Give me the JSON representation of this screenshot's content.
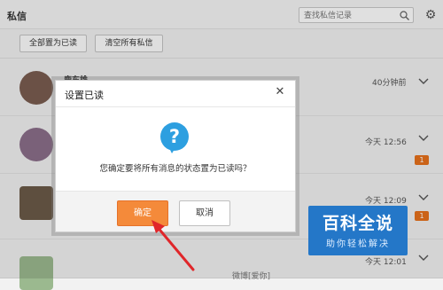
{
  "header": {
    "title": "私信",
    "search_placeholder": "查找私信记录"
  },
  "toolbar": {
    "mark_all_read": "全部置为已读",
    "clear_all": "清空所有私信"
  },
  "conversations": [
    {
      "name": "鹿东雄",
      "time": "40分钟前",
      "badge": ""
    },
    {
      "name": "",
      "time": "今天 12:56",
      "badge": "1"
    },
    {
      "name": "",
      "time": "今天 12:09",
      "badge": "1"
    },
    {
      "name": "",
      "time": "今天 12:01",
      "badge": "",
      "preview": "微博[爱你]"
    }
  ],
  "dialog": {
    "title": "设置已读",
    "message": "您确定要将所有消息的状态置为已读吗？",
    "confirm": "确定",
    "cancel": "取消"
  },
  "watermark": {
    "brand": "百科全说",
    "tagline": "助你轻松解决"
  },
  "colors": {
    "accent": "#f48a3a",
    "question_icon": "#2d9fe0",
    "badge": "#e8711c",
    "watermark_bg": "#2477c8",
    "arrow": "#e0262a"
  }
}
